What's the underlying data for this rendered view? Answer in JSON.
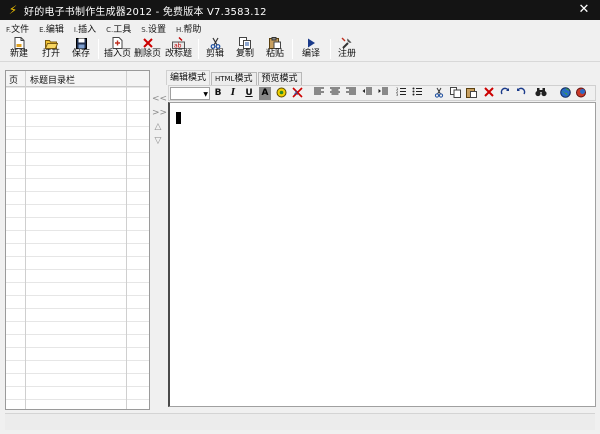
{
  "window": {
    "title": "好的电子书制作生成器2012 - 免费版本 V7.3583.12",
    "close_symbol": "✕",
    "app_icon_symbol": "⚡"
  },
  "menu": [
    {
      "accel": "F.",
      "label": "文件"
    },
    {
      "accel": "E.",
      "label": "编辑"
    },
    {
      "accel": "I.",
      "label": "插入"
    },
    {
      "accel": "C.",
      "label": "工具"
    },
    {
      "accel": "S.",
      "label": "设置"
    },
    {
      "accel": "H.",
      "label": "帮助"
    }
  ],
  "toolbar": {
    "new_label": "新建",
    "open_label": "打开",
    "save_label": "保存",
    "insert_page_label": "插入页",
    "delete_page_label": "删除页",
    "rename_label": "改标题",
    "cut_label": "剪辑",
    "copy_label": "复制",
    "paste_label": "粘贴",
    "compile_label": "编译",
    "register_label": "注册"
  },
  "left_panel": {
    "col_page": "页",
    "col_title": "标题目录栏"
  },
  "nav": {
    "prev": "<<",
    "next": ">>",
    "up": "△",
    "down": "▽"
  },
  "tabs": {
    "edit_mode": "编辑模式",
    "html_prefix": "HTML",
    "html_suffix": "模式",
    "preview_mode": "预览模式"
  },
  "editor_toolbar": {
    "bold": "B",
    "italic": "I",
    "underline": "U",
    "font_color": "A",
    "combo_arrow": "▼"
  },
  "colors": {
    "titlebar_bg": "#141414",
    "app_icon": "#f2c200",
    "delete_red": "#cc0000"
  }
}
